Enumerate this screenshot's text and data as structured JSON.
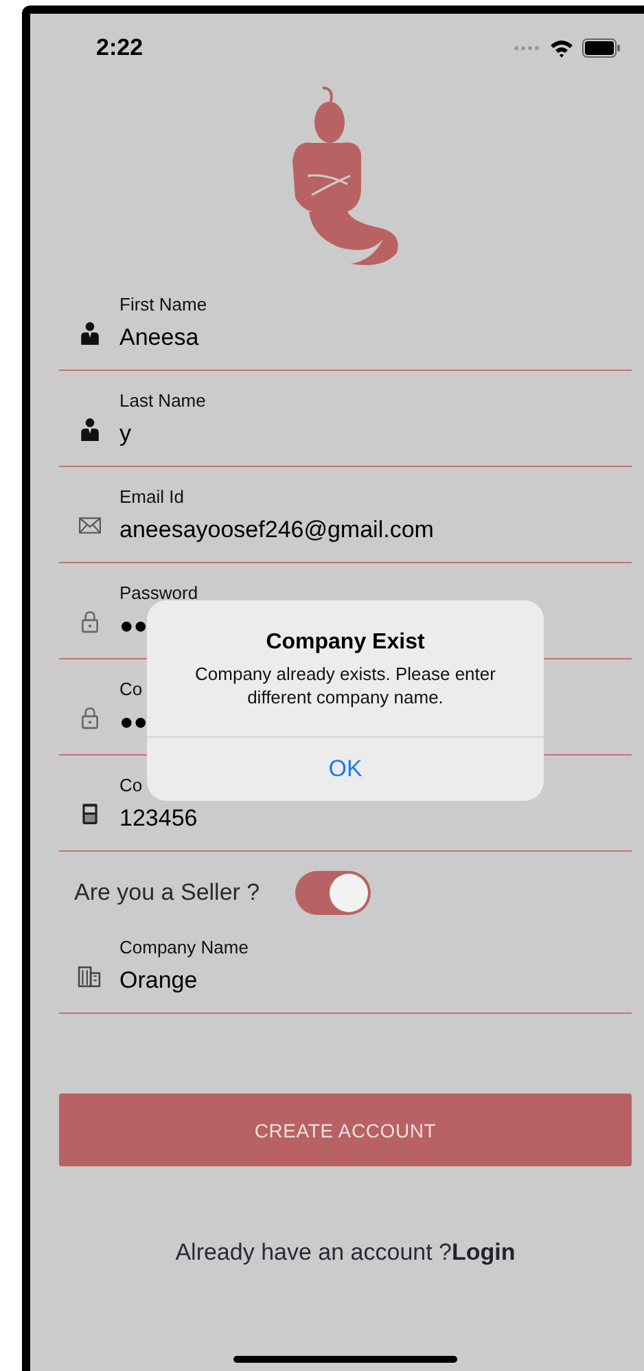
{
  "status_bar": {
    "time": "2:22"
  },
  "fields": [
    {
      "kind": "person",
      "label": "First Name",
      "value": "Aneesa"
    },
    {
      "kind": "person",
      "label": "Last Name",
      "value": "y"
    },
    {
      "kind": "mail",
      "label": "Email Id",
      "value": "aneesayoosef246@gmail.com"
    },
    {
      "kind": "lock",
      "label": "Password",
      "value": "●●"
    },
    {
      "kind": "lock",
      "label": "Co",
      "value": "●●"
    },
    {
      "kind": "phone",
      "label": "Co",
      "value": "123456"
    }
  ],
  "seller": {
    "label": "Are you a Seller ?",
    "on": true
  },
  "company_field": {
    "kind": "building",
    "label": "Company Name",
    "value": "Orange"
  },
  "create_button": "CREATE ACCOUNT",
  "login_prompt": {
    "text": "Already have an account ?",
    "link": "Login"
  },
  "alert": {
    "title": "Company Exist",
    "message": "Company already exists. Please enter different company name.",
    "button": "OK"
  }
}
